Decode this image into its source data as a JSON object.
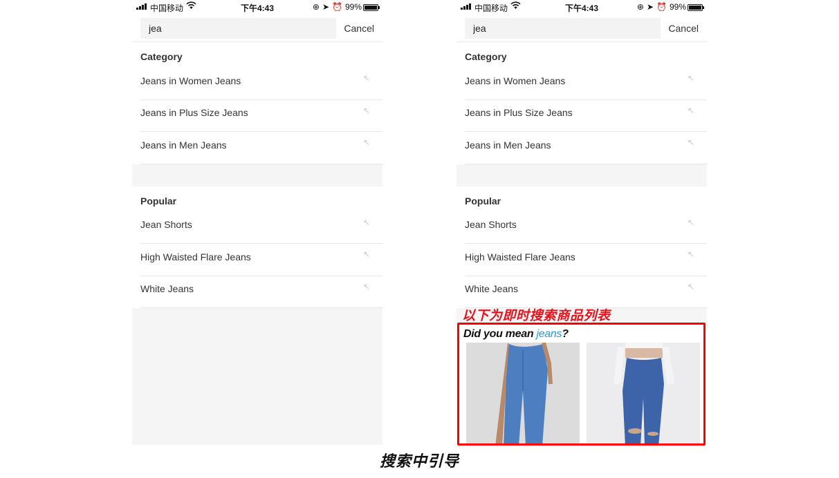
{
  "status_bar": {
    "carrier": "中国移动",
    "time": "下午4:43",
    "battery": "99%",
    "battery_level": 0.99
  },
  "search": {
    "value": "jea",
    "cancel_label": "Cancel"
  },
  "category": {
    "title": "Category",
    "items": [
      {
        "label": "Jeans in Women Jeans"
      },
      {
        "label": "Jeans in Plus Size Jeans"
      },
      {
        "label": "Jeans in Men Jeans"
      }
    ]
  },
  "popular": {
    "title": "Popular",
    "items": [
      {
        "label": "Jean Shorts"
      },
      {
        "label": "High Waisted Flare Jeans"
      },
      {
        "label": "White Jeans"
      }
    ]
  },
  "annotation": {
    "instant_results_note": "以下为即时搜索商品列表",
    "did_you_mean_prefix": "Did you mean ",
    "did_you_mean_suggestion": "jeans",
    "did_you_mean_suffix": "?",
    "products": [
      {
        "alt": "straight-leg light blue jeans"
      },
      {
        "alt": "ripped high-waist blue jeans"
      }
    ],
    "highlight_color": "#ff0000",
    "suggestion_color": "#2a9ad6"
  },
  "caption": "搜索中引导",
  "icons": {
    "fill_arrow": "↖"
  }
}
